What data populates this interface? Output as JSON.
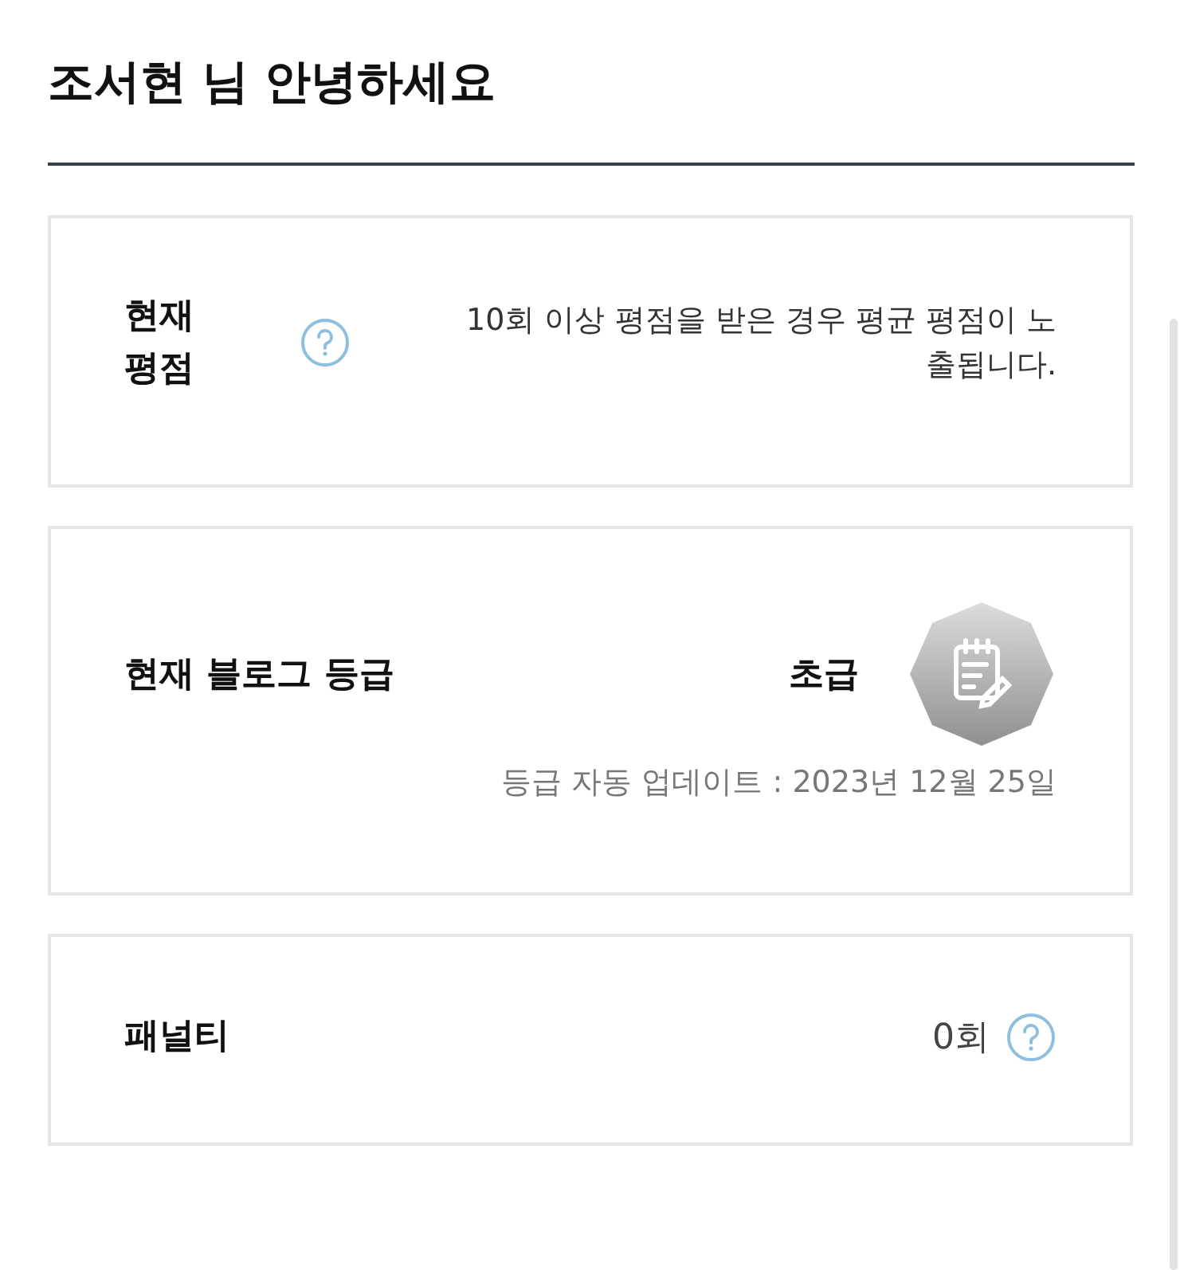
{
  "greeting": "조서현 님 안녕하세요",
  "cards": [
    {
      "kind": "rating",
      "label": "현재 평점",
      "help": true,
      "note": "10회 이상 평점을 받은 경우 평균 평점이 노출됩니다."
    },
    {
      "kind": "grade",
      "label": "현재 블로그 등급",
      "grade": "초급",
      "update": "등급 자동 업데이트 : 2023년 12월 25일"
    },
    {
      "kind": "penalty",
      "label": "패널티",
      "count": "0회",
      "help": true
    }
  ]
}
